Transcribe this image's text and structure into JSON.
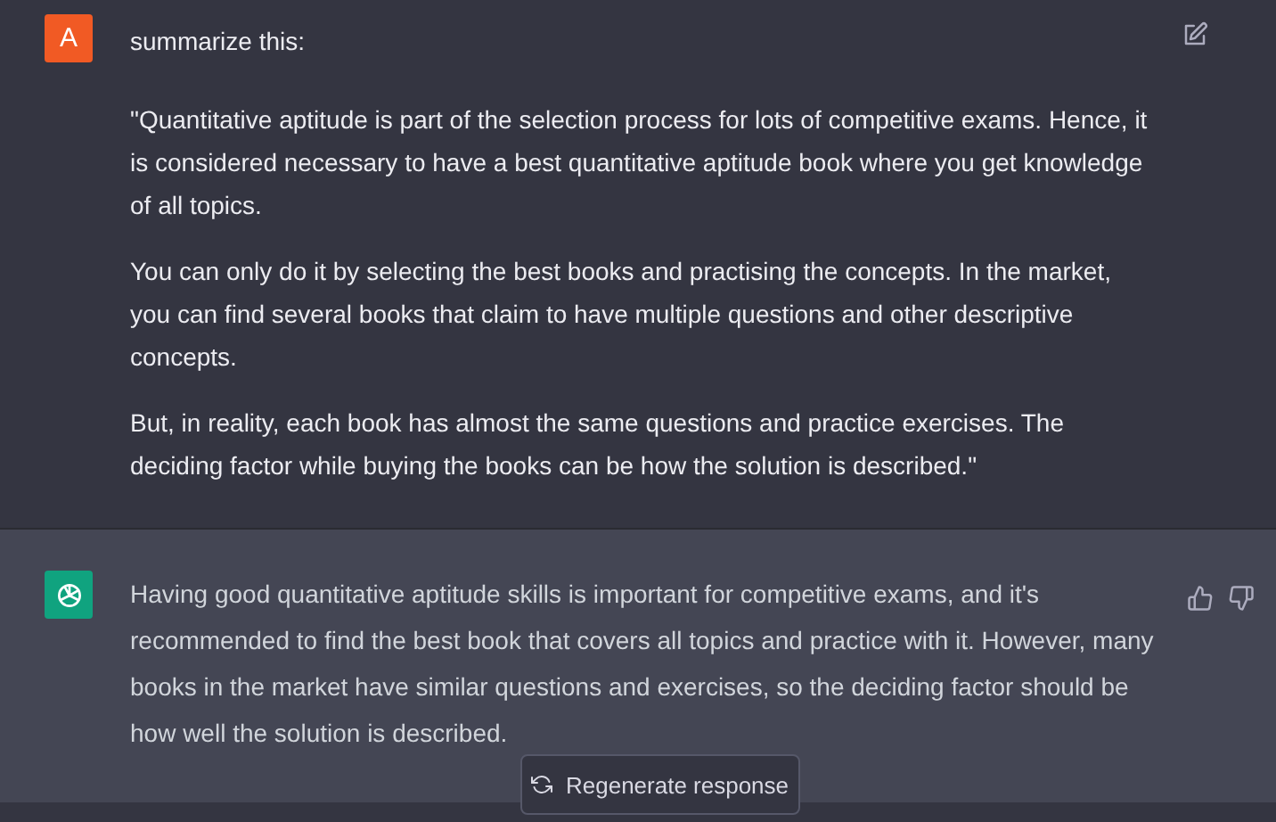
{
  "messages": [
    {
      "kind": "user",
      "avatar": "A",
      "paragraphs": [
        "summarize this:",
        "\"Quantitative aptitude is part of the selection process for lots of competitive exams. Hence, it is considered necessary to have a best quantitative aptitude book where you get knowledge of all topics.",
        "You can only do it by selecting the best books and practising the concepts. In the market, you can find several books that claim to have multiple questions and other descriptive concepts.",
        "But, in reality, each book has almost the same questions and practice exercises. The deciding factor while buying the books can be how the solution is described.\""
      ]
    },
    {
      "kind": "assistant",
      "paragraphs": [
        "Having good quantitative aptitude skills is important for competitive exams, and it's recommended to find the best book that covers all topics and practice with it. However, many books in the market have similar questions and exercises, so the deciding factor should be how well the solution is described."
      ]
    }
  ],
  "regenerate_button": {
    "label": "Regenerate response"
  }
}
